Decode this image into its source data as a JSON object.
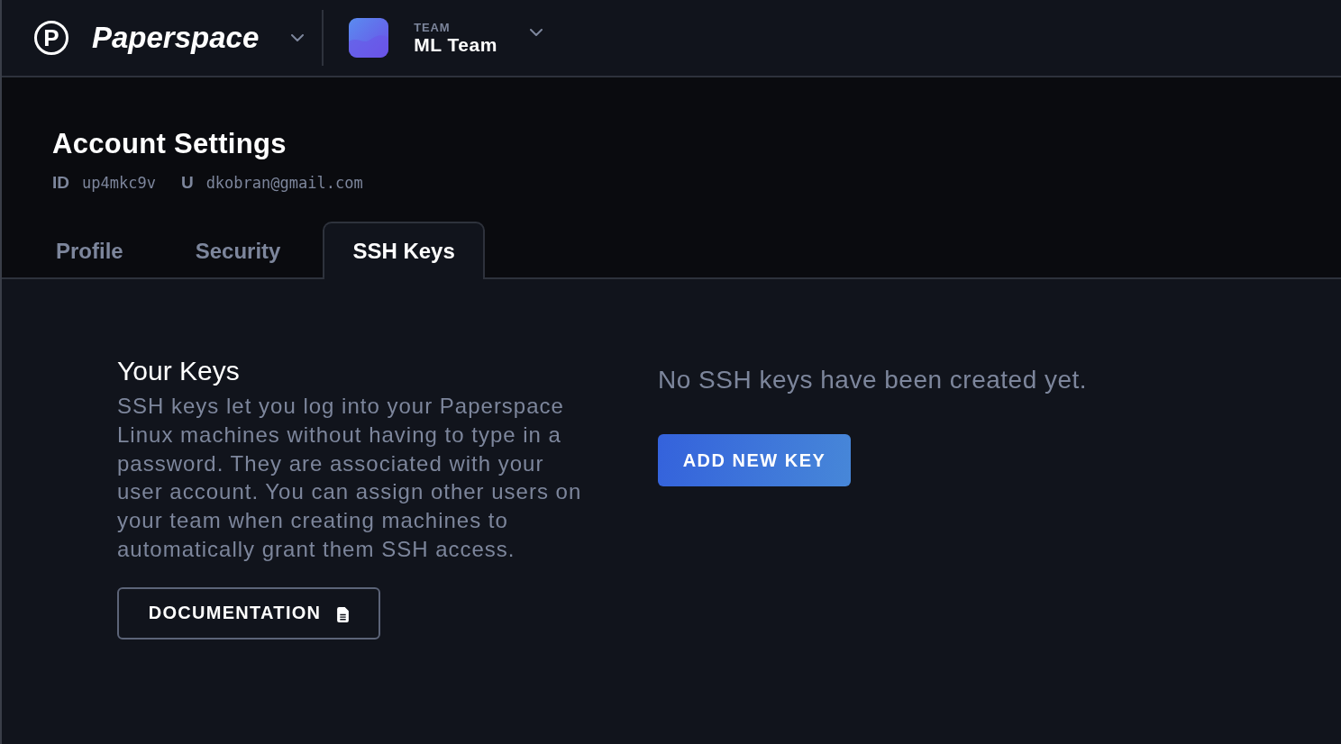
{
  "top_bar": {
    "brand": {
      "logo_letter": "P",
      "name": "Paperspace"
    },
    "team": {
      "caption": "TEAM",
      "name": "ML Team"
    }
  },
  "header": {
    "title": "Account Settings",
    "meta": [
      {
        "label": "ID",
        "value": "up4mkc9v"
      },
      {
        "label": "U",
        "value": "dkobran@gmail.com"
      }
    ],
    "tabs": [
      {
        "label": "Profile",
        "selected": false
      },
      {
        "label": "Security",
        "selected": false
      },
      {
        "label": "SSH Keys",
        "selected": true
      }
    ]
  },
  "keys_section": {
    "title": "Your Keys",
    "description": "SSH keys let you log into your Paperspace Linux machines without having to type in a password. They are associated with your user account. You can assign other users on your team when creating machines to automatically grant them SSH access.",
    "documentation_button": "DOCUMENTATION"
  },
  "empty_state": {
    "message": "No SSH keys have been created yet.",
    "add_button": "ADD NEW KEY"
  }
}
